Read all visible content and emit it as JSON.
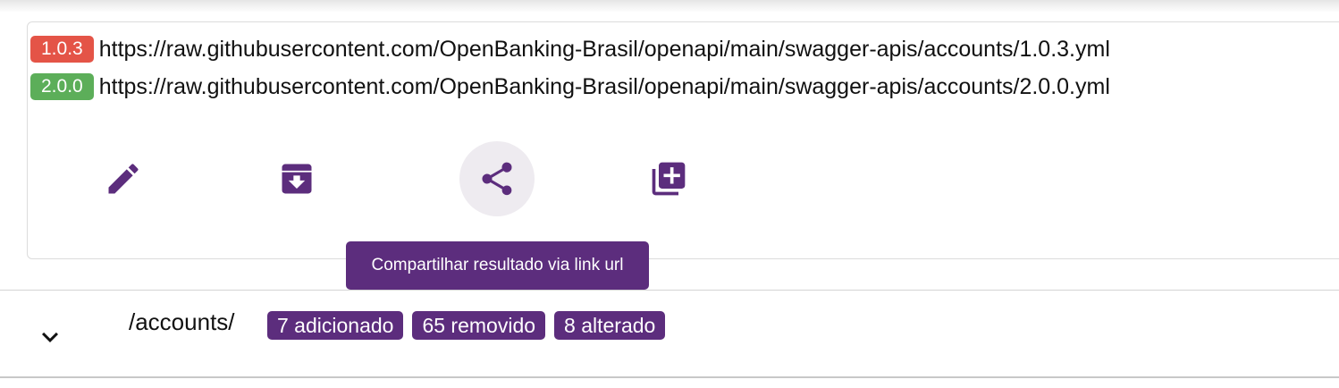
{
  "specs": [
    {
      "version": "1.0.3",
      "url": "https://raw.githubusercontent.com/OpenBanking-Brasil/openapi/main/swagger-apis/accounts/1.0.3.yml",
      "badge_color": "#e45447"
    },
    {
      "version": "2.0.0",
      "url": "https://raw.githubusercontent.com/OpenBanking-Brasil/openapi/main/swagger-apis/accounts/2.0.0.yml",
      "badge_color": "#5cae59"
    }
  ],
  "actions": {
    "edit_icon": "pencil-icon",
    "archive_icon": "archive-download-icon",
    "share_icon": "share-icon",
    "copy_icon": "library-add-icon",
    "share_tooltip": "Compartilhar resultado via link url"
  },
  "diff": {
    "path": "/accounts/",
    "chips": [
      "7 adicionado",
      "65 removido",
      "8 alterado"
    ],
    "expand_icon": "chevron-down-icon"
  },
  "colors": {
    "accent": "#5c2d7d",
    "hover_bg": "#eeebf0"
  }
}
